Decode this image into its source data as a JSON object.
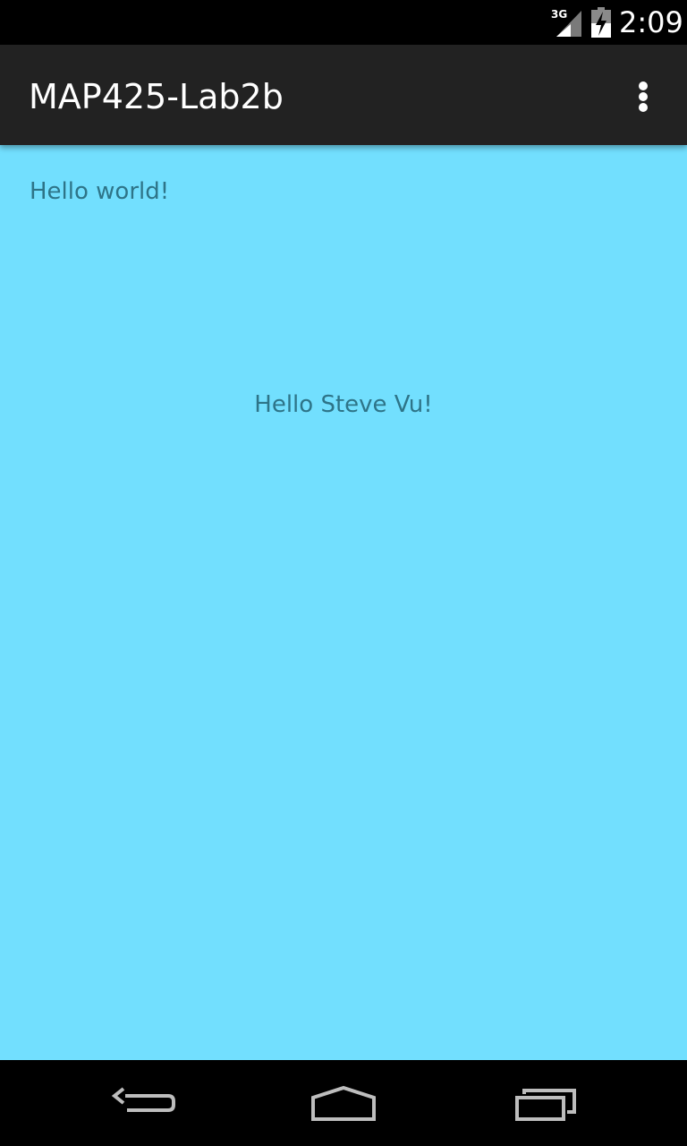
{
  "status_bar": {
    "network_label": "3G",
    "time": "2:09",
    "icons": [
      "signal-3g-icon",
      "battery-charging-icon"
    ]
  },
  "action_bar": {
    "title": "MAP425-Lab2b",
    "overflow_icon": "more-vert-icon"
  },
  "content": {
    "background": "#72dffe",
    "text_color": "#2e7488",
    "hello_world": "Hello world!",
    "hello_name": "Hello Steve Vu!"
  },
  "nav_bar": {
    "buttons": [
      "back-icon",
      "home-icon",
      "recents-icon"
    ]
  }
}
